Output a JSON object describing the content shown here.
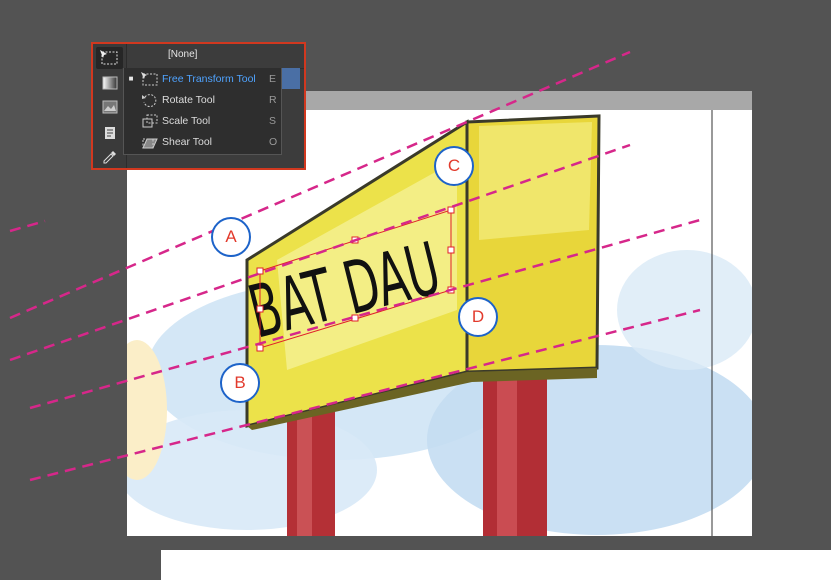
{
  "swatch_panel": {
    "label": "[None]"
  },
  "flyout_menu": {
    "items": [
      {
        "label": "Free Transform Tool",
        "shortcut": "E",
        "selected": true,
        "icon": "free-transform-icon"
      },
      {
        "label": "Rotate Tool",
        "shortcut": "R",
        "selected": false,
        "icon": "rotate-icon"
      },
      {
        "label": "Scale Tool",
        "shortcut": "S",
        "selected": false,
        "icon": "scale-icon"
      },
      {
        "label": "Shear Tool",
        "shortcut": "O",
        "selected": false,
        "icon": "shear-icon"
      }
    ]
  },
  "toolbar": {
    "tools": [
      "free-transform-icon",
      "gradient-swatch-icon",
      "gradient-feather-icon",
      "note-icon",
      "eyedropper-icon"
    ]
  },
  "artwork": {
    "sign_text": "BAT DAU"
  },
  "callouts": {
    "a": "A",
    "b": "B",
    "c": "C",
    "d": "D"
  },
  "colors": {
    "guide": "#d6278a",
    "callout_border": "#1d63c9",
    "callout_text": "#e23a2c",
    "toolbar_border": "#d1381f",
    "selection": "#e0202a"
  }
}
